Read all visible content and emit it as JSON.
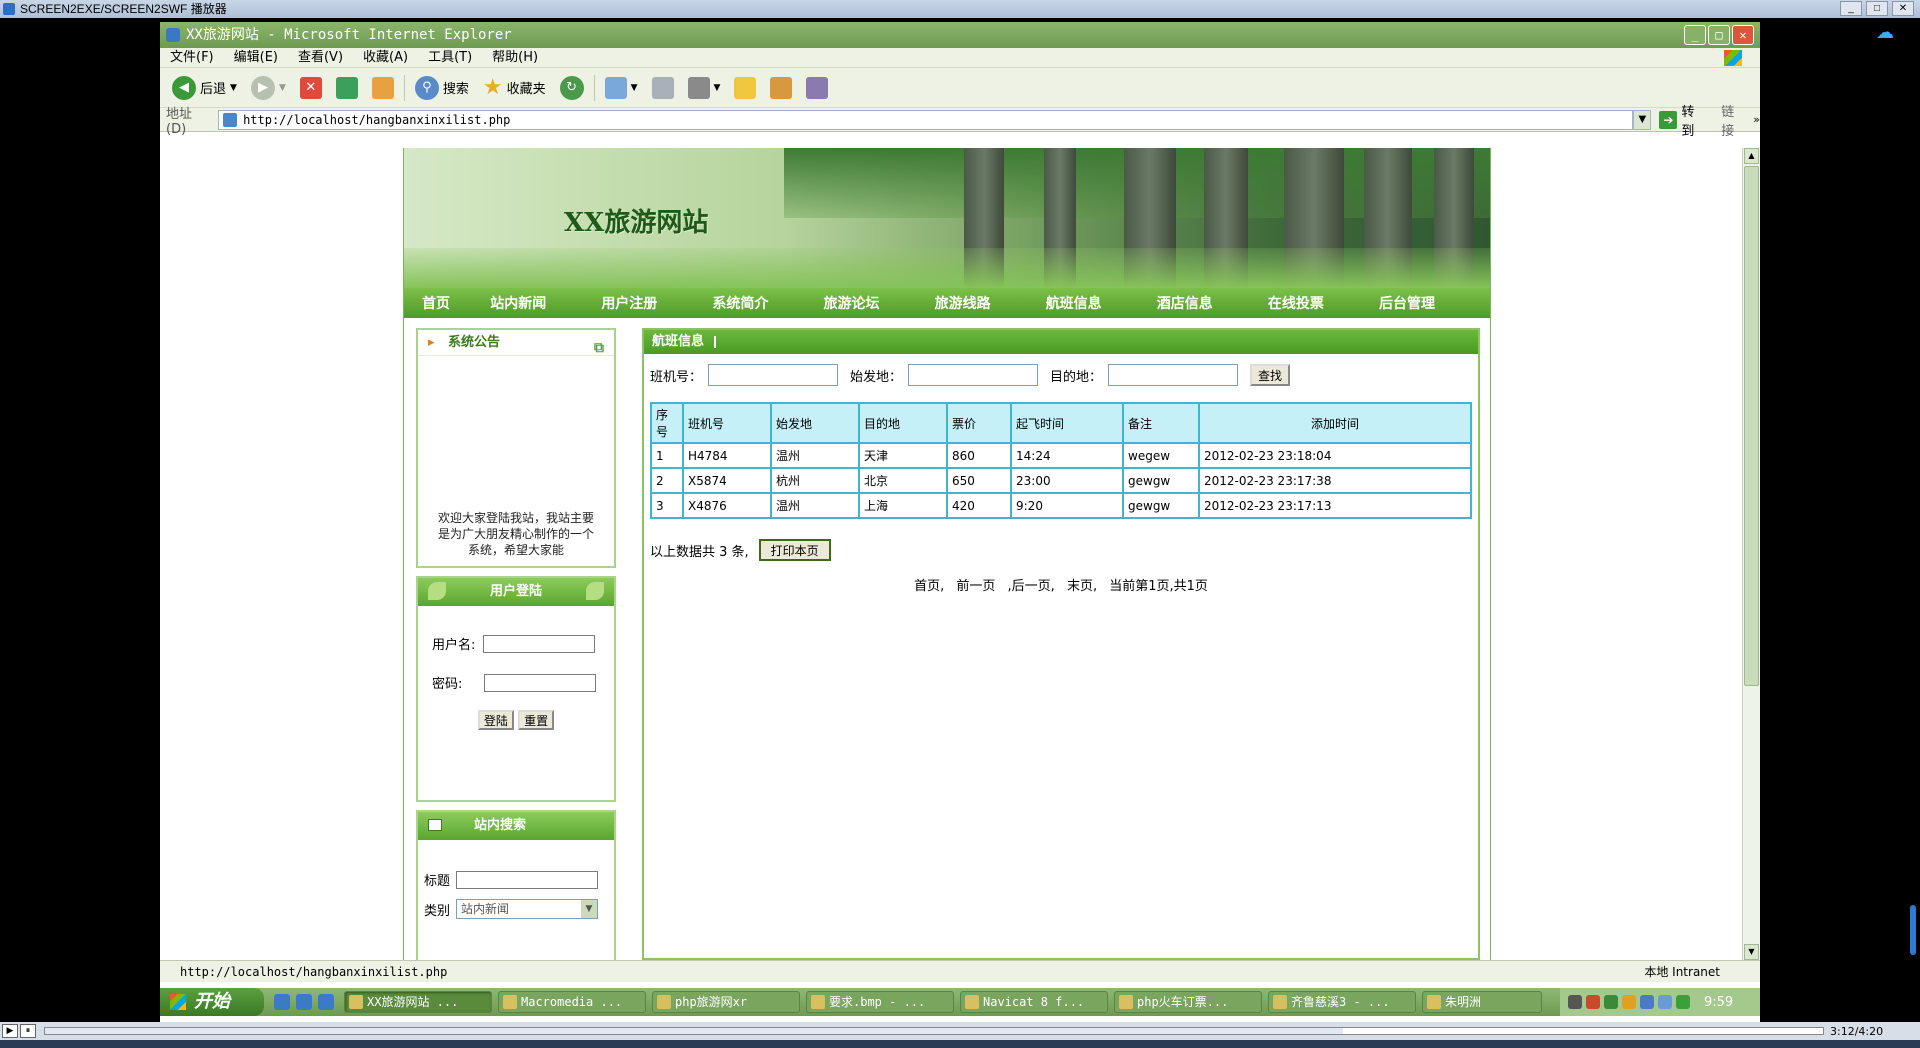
{
  "player": {
    "title": "SCREEN2EXE/SCREEN2SWF 播放器",
    "time": "3:12/4:20",
    "progress": 0.73
  },
  "ie": {
    "title": "XX旅游网站 - Microsoft Internet Explorer",
    "menu": [
      "文件(F)",
      "编辑(E)",
      "查看(V)",
      "收藏(A)",
      "工具(T)",
      "帮助(H)"
    ],
    "toolbar": {
      "back": "后退",
      "search": "搜索",
      "favorites": "收藏夹"
    },
    "address_label": "地址(D)",
    "address": "http://localhost/hangbanxinxilist.php",
    "go": "转到",
    "links": "链接",
    "status_url": "http://localhost/hangbanxinxilist.php",
    "status_zone": "本地 Intranet"
  },
  "site": {
    "title": "XX旅游网站",
    "nav": [
      "首页",
      "站内新闻",
      "用户注册",
      "系统简介",
      "旅游论坛",
      "旅游线路",
      "航班信息",
      "酒店信息",
      "在线投票",
      "后台管理"
    ],
    "notice": {
      "title": "系统公告",
      "text": "欢迎大家登陆我站，我站主要是为广大朋友精心制作的一个系统，希望大家能"
    },
    "login": {
      "title": "用户登陆",
      "username_label": "用户名:",
      "password_label": "密码:",
      "login_btn": "登陆",
      "reset_btn": "重置"
    },
    "search": {
      "title": "站内搜索",
      "title_label": "标题",
      "category_label": "类别",
      "category_value": "站内新闻"
    },
    "flights": {
      "title": "航班信息",
      "filter": {
        "flight_no": "班机号：",
        "origin": "始发地：",
        "destination": "目的地：",
        "search_btn": "查找"
      },
      "columns": [
        "序号",
        "班机号",
        "始发地",
        "目的地",
        "票价",
        "起飞时间",
        "备注",
        "添加时间"
      ],
      "rows": [
        [
          "1",
          "H4784",
          "温州",
          "天津",
          "860",
          "14:24",
          "wegew",
          "2012-02-23 23:18:04"
        ],
        [
          "2",
          "X5874",
          "杭州",
          "北京",
          "650",
          "23:00",
          "gewgw",
          "2012-02-23 23:17:38"
        ],
        [
          "3",
          "X4876",
          "温州",
          "上海",
          "420",
          "9:20",
          "gewgw",
          "2012-02-23 23:17:13"
        ]
      ],
      "summary": "以上数据共 3 条,",
      "print_btn": "打印本页",
      "pager": [
        "首页,",
        "前一页",
        ",后一页,",
        "末页,",
        "当前第1页,共1页"
      ]
    }
  },
  "taskbar": {
    "start": "开始",
    "tasks": [
      "XX旅游网站 ...",
      "Macromedia ...",
      "php旅游网xr",
      "要求.bmp - ...",
      "Navicat 8 f...",
      "php火车订票...",
      "齐鲁慈溪3 - ...",
      "朱明洲"
    ],
    "clock": "9:59"
  }
}
